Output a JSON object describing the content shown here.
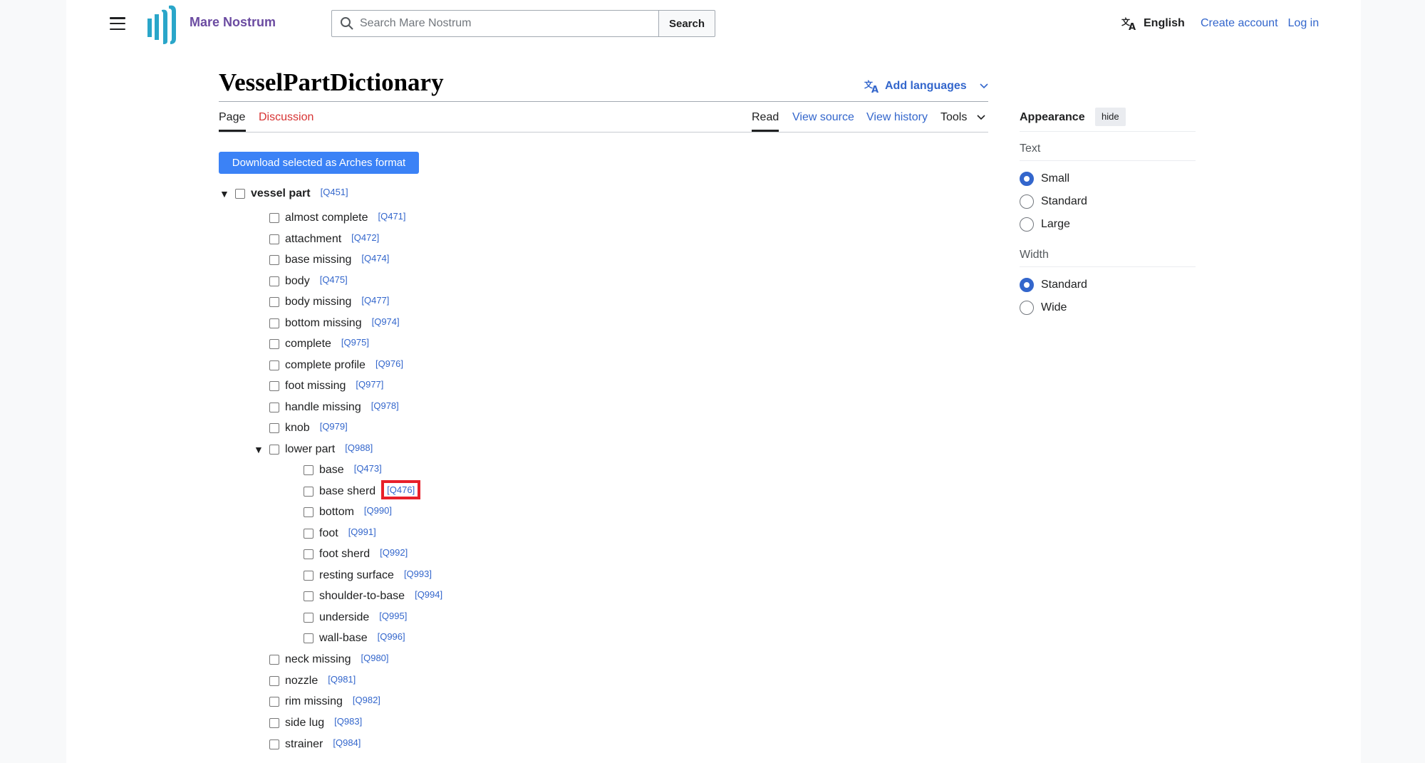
{
  "header": {
    "site_name": "Mare Nostrum",
    "search_placeholder": "Search Mare Nostrum",
    "search_button": "Search",
    "language": "English",
    "create_account": "Create account",
    "log_in": "Log in"
  },
  "page": {
    "title": "VesselPartDictionary",
    "add_languages": "Add languages"
  },
  "tabs": {
    "page": "Page",
    "discussion": "Discussion",
    "read": "Read",
    "view_source": "View source",
    "view_history": "View history",
    "tools": "Tools"
  },
  "appearance": {
    "title": "Appearance",
    "hide": "hide",
    "text_heading": "Text",
    "text_options": [
      "Small",
      "Standard",
      "Large"
    ],
    "text_selected": "Small",
    "width_heading": "Width",
    "width_options": [
      "Standard",
      "Wide"
    ],
    "width_selected": "Standard"
  },
  "download_button": "Download selected as Arches format",
  "tree": {
    "root": {
      "label": "vessel part",
      "qid": "[Q451]"
    },
    "items": [
      {
        "label": "almost complete",
        "qid": "[Q471]"
      },
      {
        "label": "attachment",
        "qid": "[Q472]"
      },
      {
        "label": "base missing",
        "qid": "[Q474]"
      },
      {
        "label": "body",
        "qid": "[Q475]"
      },
      {
        "label": "body missing",
        "qid": "[Q477]"
      },
      {
        "label": "bottom missing",
        "qid": "[Q974]"
      },
      {
        "label": "complete",
        "qid": "[Q975]"
      },
      {
        "label": "complete profile",
        "qid": "[Q976]"
      },
      {
        "label": "foot missing",
        "qid": "[Q977]"
      },
      {
        "label": "handle missing",
        "qid": "[Q978]"
      },
      {
        "label": "knob",
        "qid": "[Q979]"
      },
      {
        "label": "lower part",
        "qid": "[Q988]"
      },
      {
        "label": "neck missing",
        "qid": "[Q980]"
      },
      {
        "label": "nozzle",
        "qid": "[Q981]"
      },
      {
        "label": "rim missing",
        "qid": "[Q982]"
      },
      {
        "label": "side lug",
        "qid": "[Q983]"
      },
      {
        "label": "strainer",
        "qid": "[Q984]"
      }
    ],
    "lower_part_children": [
      {
        "label": "base",
        "qid": "[Q473]"
      },
      {
        "label": "base sherd",
        "qid": "[Q476]"
      },
      {
        "label": "bottom",
        "qid": "[Q990]"
      },
      {
        "label": "foot",
        "qid": "[Q991]"
      },
      {
        "label": "foot sherd",
        "qid": "[Q992]"
      },
      {
        "label": "resting surface",
        "qid": "[Q993]"
      },
      {
        "label": "shoulder-to-base",
        "qid": "[Q994]"
      },
      {
        "label": "underside",
        "qid": "[Q995]"
      },
      {
        "label": "wall-base",
        "qid": "[Q996]"
      }
    ]
  },
  "icons": {
    "menu": "hamburger-menu-icon",
    "logo": "mare-nostrum-logo-icon",
    "search": "search-icon",
    "language": "translate-icon",
    "chevron": "chevron-down-icon",
    "expand": "triangle-down-icon"
  },
  "colors": {
    "link": "#3366cc",
    "discussion": "#d73333",
    "logo_text": "#6b4ba1",
    "logo_icon": "#2aa6c9",
    "download_button": "#3b82f6",
    "highlight_box": "#e8202a"
  }
}
